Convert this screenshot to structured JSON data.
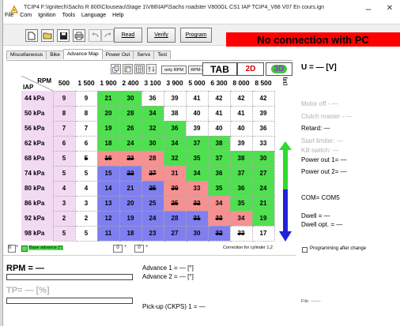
{
  "window": {
    "title": "TCIP4    F:\\Ignitech\\Sachs R 800\\Clouseau\\Stage 1\\V88\\IAP\\Sachs roadster V800GL CS1 IAP TCIP4_V88 V07 En cours.ign",
    "minimize_glyph": "–",
    "close_glyph": "✕"
  },
  "menu": [
    "File",
    "Com",
    "Ignition",
    "Tools",
    "Language",
    "Help"
  ],
  "toolbar": {
    "read_label": "Read",
    "verify_label": "Verify",
    "program_label": "Program",
    "status_banner": "No connection with PC"
  },
  "tabs": [
    "Miscellaneous",
    "Bike",
    "Advance Map",
    "Power Out",
    "Servo",
    "Test"
  ],
  "map_controls": {
    "only_rpm_label": "only RPM",
    "rpm_iap_label": "RPM and IAP",
    "tab_label": "TAB",
    "btn_2d_label": "2D",
    "btn_3d_label": "3D",
    "unit_10_label": "(10)"
  },
  "table": {
    "rpm_label": "RPM",
    "iap_label": "IAP",
    "rpm_columns": [
      "500",
      "1 500",
      "1 900",
      "2 400",
      "3 100",
      "3 900",
      "5 000",
      "6 300",
      "8 000",
      "8 500"
    ],
    "rows": [
      {
        "iap": "44 kPa",
        "values": [
          "9",
          "9",
          "21",
          "30",
          "36",
          "39",
          "41",
          "42",
          "42",
          "42"
        ]
      },
      {
        "iap": "50 kPa",
        "values": [
          "8",
          "8",
          "20",
          "28",
          "34",
          "38",
          "40",
          "41",
          "41",
          "39"
        ]
      },
      {
        "iap": "56 kPa",
        "values": [
          "7",
          "7",
          "19",
          "26",
          "32",
          "36",
          "39",
          "40",
          "40",
          "36"
        ]
      },
      {
        "iap": "62 kPa",
        "values": [
          "6",
          "6",
          "18",
          "24",
          "30",
          "34",
          "37",
          "38",
          "39",
          "33"
        ]
      },
      {
        "iap": "68 kPa",
        "values": [
          "5",
          "5",
          "16",
          "23",
          "28",
          "32",
          "35",
          "37",
          "38",
          "30"
        ]
      },
      {
        "iap": "74 kPa",
        "values": [
          "5",
          "5",
          "15",
          "22",
          "27",
          "31",
          "34",
          "36",
          "37",
          "27"
        ]
      },
      {
        "iap": "80 kPa",
        "values": [
          "4",
          "4",
          "14",
          "21",
          "25",
          "30",
          "33",
          "35",
          "36",
          "24"
        ]
      },
      {
        "iap": "86 kPa",
        "values": [
          "3",
          "3",
          "13",
          "20",
          "25",
          "25",
          "32",
          "34",
          "35",
          "21"
        ]
      },
      {
        "iap": "92 kPa",
        "values": [
          "2",
          "2",
          "12",
          "19",
          "24",
          "28",
          "31",
          "33",
          "34",
          "19"
        ]
      },
      {
        "iap": "98 kPa",
        "values": [
          "5",
          "5",
          "11",
          "18",
          "23",
          "27",
          "30",
          "32",
          "33",
          "17"
        ]
      }
    ],
    "colors": {
      "green": "#4fe04f",
      "red": "#f79090",
      "purple": "#7f7ff0",
      "header": "#f3daf3"
    }
  },
  "right_panel": {
    "voltage": "U = — [V]",
    "motor_off": "Motor off - —",
    "clutch_master": "Clutch master - —",
    "retard": "Retard: —",
    "start_limiter": "Start limiter: —",
    "kill_switch": "Kill switch: —",
    "power_out_1": "Power out 1= —",
    "power_out_2": "Power out 2= —",
    "com": "COM= COM5",
    "dwell": "Dwell = —",
    "dwell_opt": "Dwell opt. = —"
  },
  "bottom": {
    "spin1_value": "0",
    "base_advance_label": "Base advance [°]",
    "spin2_value": "0",
    "spin3_value": "0",
    "correction_label": "Correction for cylinder 1,2",
    "programming_label": "Programming after change",
    "rpm_readout": "RPM = —",
    "tp_readout": "TP= — [%]",
    "advance_1": "Advance 1 = — [°]",
    "advance_2": "Advance 2 = — [°]",
    "pickup": "Pick-up (CKPS) 1 = —",
    "file_label": "File: -------"
  }
}
